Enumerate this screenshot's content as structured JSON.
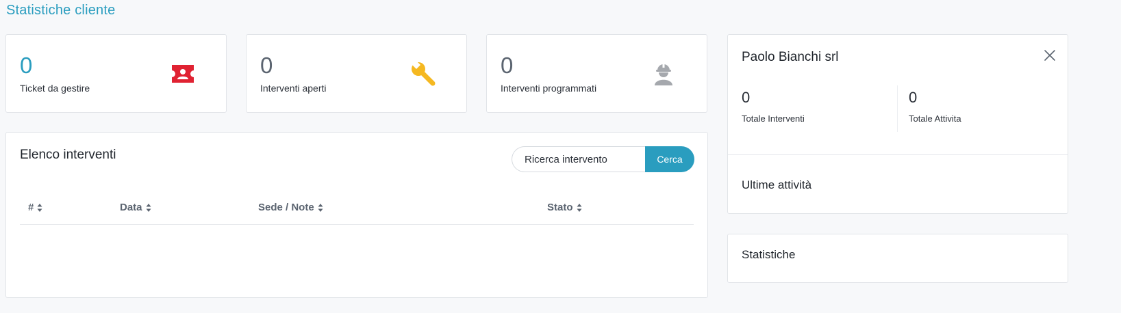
{
  "page": {
    "title": "Statistiche cliente"
  },
  "stats": [
    {
      "value": "0",
      "label": "Ticket da gestire",
      "icon": "ticket-icon",
      "color": "#e02232"
    },
    {
      "value": "0",
      "label": "Interventi aperti",
      "icon": "wrench-icon",
      "color": "#f5b821"
    },
    {
      "value": "0",
      "label": "Interventi programmati",
      "icon": "worker-icon",
      "color": "#a5a8ad"
    }
  ],
  "interventions": {
    "title": "Elenco interventi",
    "search": {
      "placeholder": "Ricerca intervento",
      "button": "Cerca"
    },
    "columns": [
      "#",
      "Data",
      "Sede / Note",
      "Stato"
    ],
    "rows": []
  },
  "client": {
    "name": "Paolo Bianchi srl",
    "total_interventions": {
      "value": "0",
      "label": "Totale Interventi"
    },
    "total_activities": {
      "value": "0",
      "label": "Totale Attivita"
    },
    "recent_activities_title": "Ultime attività"
  },
  "statistics": {
    "title": "Statistiche"
  },
  "colors": {
    "accent": "#2a9dbf",
    "danger": "#e02232",
    "warning": "#f5b821",
    "muted": "#a5a8ad"
  }
}
